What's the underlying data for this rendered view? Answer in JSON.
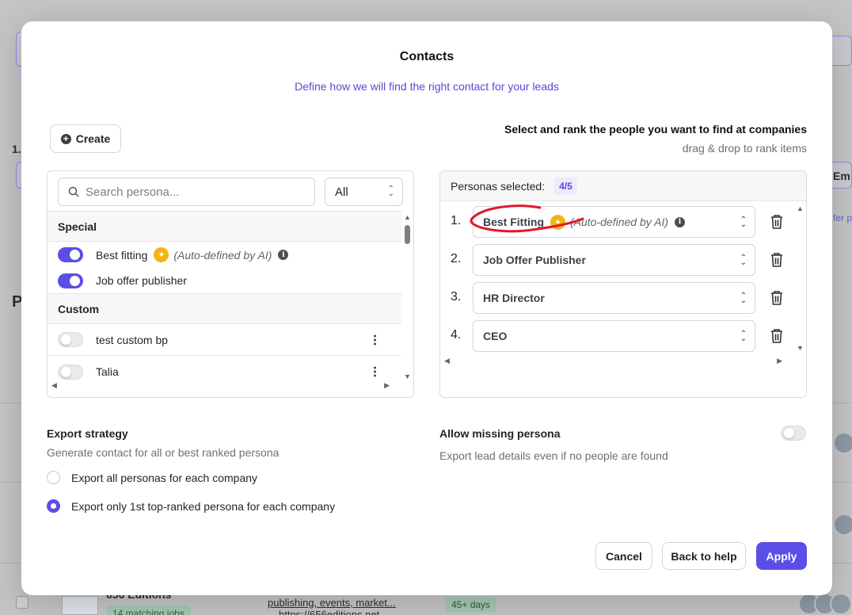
{
  "background": {
    "left_num": "1.",
    "left_letter": "P",
    "right_text": "Em",
    "right_link": "fer p",
    "company_name": "656 Editions",
    "matching_jobs": "14 matching jobs",
    "tags": "publishing, events, market...",
    "url": "https://656editions.net",
    "days_badge": "45+ days"
  },
  "modal": {
    "title": "Contacts",
    "subtitle": "Define how we will find the right contact for your leads",
    "create_label": "Create",
    "rank_title": "Select and rank the people you want to find at companies",
    "rank_hint": "drag & drop to rank items"
  },
  "left_panel": {
    "search_placeholder": "Search persona...",
    "filter_value": "All",
    "sections": [
      {
        "title": "Special",
        "items": [
          {
            "label": "Best fitting",
            "note": "(Auto-defined by AI)",
            "enabled": true
          },
          {
            "label": "Job offer publisher",
            "enabled": true
          }
        ]
      },
      {
        "title": "Custom",
        "items": [
          {
            "label": "test custom bp",
            "enabled": false
          },
          {
            "label": "Talia",
            "enabled": false
          }
        ]
      }
    ]
  },
  "right_panel": {
    "selected_label": "Personas selected:",
    "selected_count": "4/5",
    "ranked": [
      {
        "num": "1.",
        "label": "Best Fitting",
        "note": "(Auto-defined by AI)"
      },
      {
        "num": "2.",
        "label": "Job Offer Publisher"
      },
      {
        "num": "3.",
        "label": "HR Director"
      },
      {
        "num": "4.",
        "label": "CEO"
      }
    ]
  },
  "export": {
    "title": "Export strategy",
    "description": "Generate contact for all or best ranked persona",
    "options": [
      {
        "label": "Export all personas for each company",
        "checked": false
      },
      {
        "label": "Export only 1st top-ranked persona for each company",
        "checked": true
      }
    ]
  },
  "missing": {
    "title": "Allow missing persona",
    "description": "Export lead details even if no people are found",
    "enabled": false
  },
  "footer": {
    "cancel": "Cancel",
    "back": "Back to help",
    "apply": "Apply"
  },
  "colors": {
    "accent": "#5b4ee6",
    "ai_badge": "#f2b413",
    "annotation": "#e0192a"
  }
}
